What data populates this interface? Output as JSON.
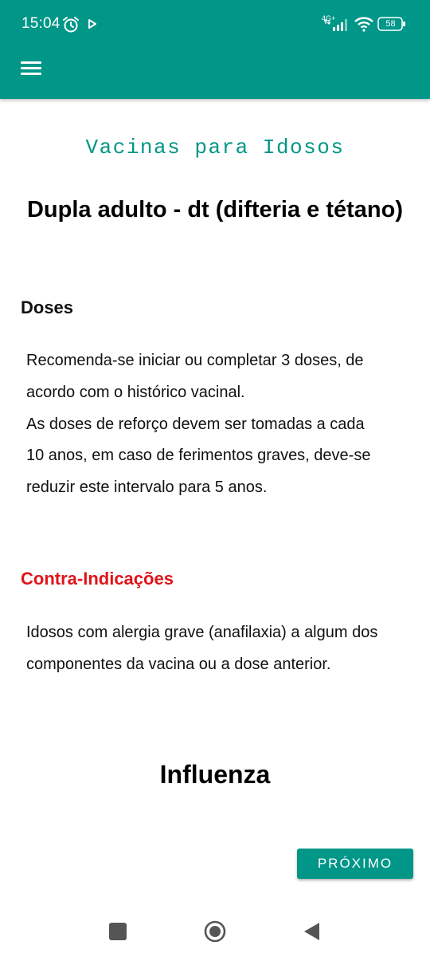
{
  "status_bar": {
    "time": "15:04",
    "network": "4G+",
    "battery": "58",
    "icons": [
      "alarm-icon",
      "play-icon",
      "signal-icon",
      "wifi-icon",
      "battery-icon"
    ]
  },
  "toolbar": {
    "menu_icon": "hamburger-menu-icon"
  },
  "app_title": "Vacinas para Idosos",
  "vaccine": {
    "title": "Dupla adulto - dt (difteria e tétano)",
    "doses_heading": "Doses",
    "doses_lines": [
      "Recomenda-se iniciar ou completar 3 doses, de",
      "acordo com o histórico vacinal.",
      "As doses de reforço devem ser tomadas a cada",
      "10 anos, em caso de ferimentos graves, deve-se",
      "reduzir este intervalo para 5 anos."
    ],
    "contra_heading": "Contra-Indicações",
    "contra_lines": [
      "Idosos com alergia grave (anafilaxia) a algum dos",
      "componentes da vacina ou a dose anterior."
    ]
  },
  "next_vaccine_title": "Influenza",
  "next_button_label": "PRÓXIMO",
  "colors": {
    "primary": "#009688",
    "contra_heading": "#e0141a"
  },
  "nav_bar": {
    "icons": [
      "recents-square-icon",
      "home-circle-icon",
      "back-triangle-icon"
    ]
  }
}
